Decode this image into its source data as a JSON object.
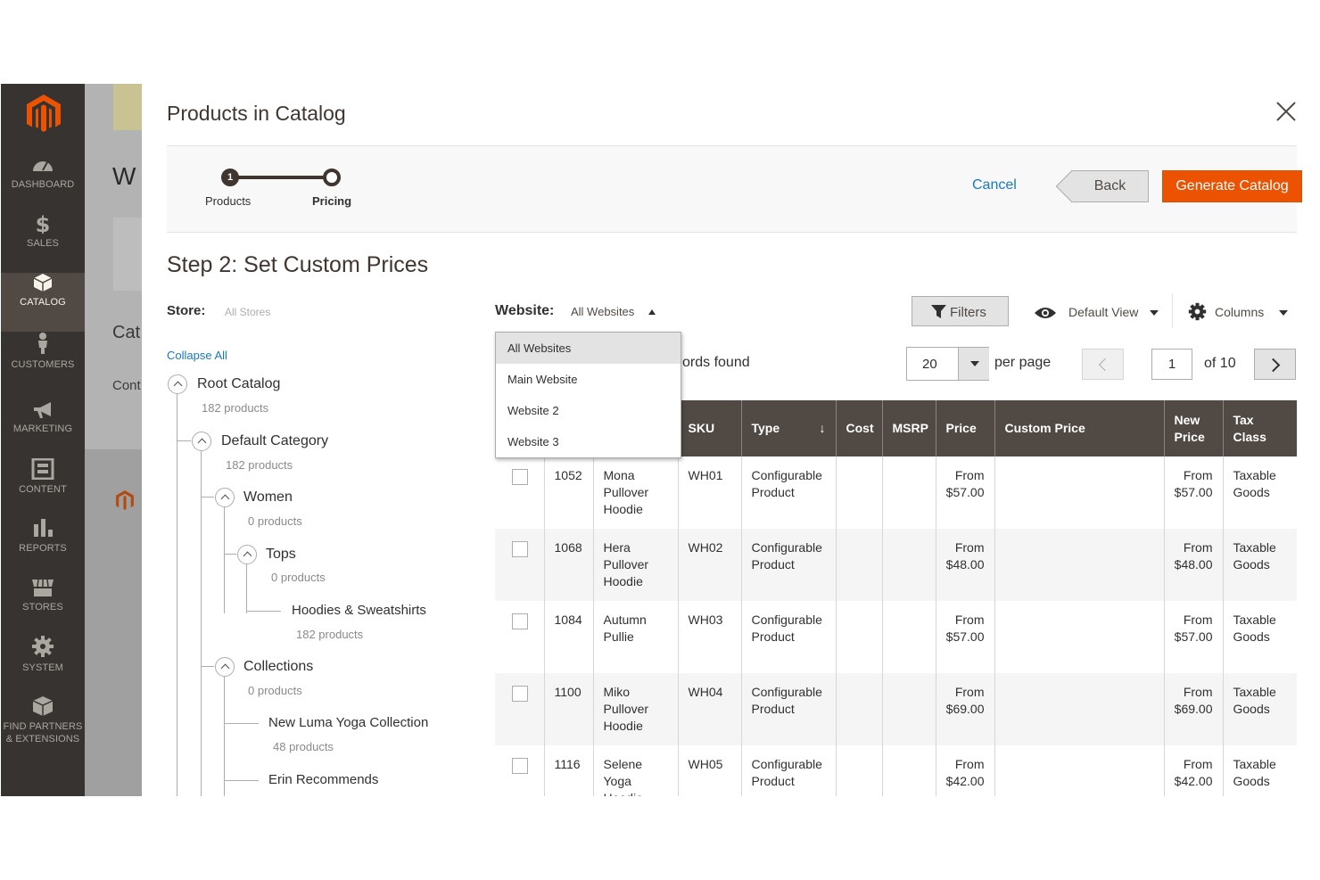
{
  "admin_nav": {
    "items": [
      {
        "label": "DASHBOARD",
        "icon": "dashboard-icon"
      },
      {
        "label": "SALES",
        "icon": "dollar-icon"
      },
      {
        "label": "CATALOG",
        "icon": "cube-icon"
      },
      {
        "label": "CUSTOMERS",
        "icon": "person-icon"
      },
      {
        "label": "MARKETING",
        "icon": "megaphone-icon"
      },
      {
        "label": "CONTENT",
        "icon": "content-icon"
      },
      {
        "label": "REPORTS",
        "icon": "bar-chart-icon"
      },
      {
        "label": "STORES",
        "icon": "store-icon"
      },
      {
        "label": "SYSTEM",
        "icon": "gear-icon"
      },
      {
        "label_1": "FIND PARTNERS",
        "label_2": "& EXTENSIONS",
        "icon": "box-icon"
      }
    ],
    "active": "CATALOG"
  },
  "background_page": {
    "title_fragment": "W",
    "label_fragment_1": "Cat",
    "label_fragment_2": "Cont"
  },
  "modal": {
    "title": "Products in Catalog",
    "steps": [
      {
        "number": "1",
        "label": "Products"
      },
      {
        "label": "Pricing"
      }
    ],
    "cancel_label": "Cancel",
    "back_label": "Back",
    "generate_label": "Generate Catalog",
    "step_title": "Step 2: Set Custom Prices"
  },
  "tree": {
    "store_label": "Store:",
    "store_value": "All Stores",
    "collapse_label": "Collapse All",
    "nodes": [
      {
        "name": "Root Catalog",
        "count": "182 products"
      },
      {
        "name": "Default Category",
        "count": "182 products"
      },
      {
        "name": "Women",
        "count": "0 products"
      },
      {
        "name": "Tops",
        "count": "0 products"
      },
      {
        "name": "Hoodies & Sweatshirts",
        "count": "182 products"
      },
      {
        "name": "Collections",
        "count": "0 products"
      },
      {
        "name": "New Luma Yoga Collection",
        "count": "48 products"
      },
      {
        "name": "Erin Recommends"
      }
    ]
  },
  "toolbar": {
    "website_label": "Website:",
    "website_value": "All Websites",
    "website_options": [
      "All Websites",
      "Main Website",
      "Website 2",
      "Website 3"
    ],
    "records_found": "ords found",
    "filters_label": "Filters",
    "view_label": "Default View",
    "columns_label": "Columns",
    "per_page_value": "20",
    "per_page_label": "per page",
    "page_value": "1",
    "page_of": "of 10"
  },
  "grid": {
    "headers": [
      "SKU",
      "Type",
      "Cost",
      "MSRP",
      "Price",
      "Custom Price",
      "New Price",
      "Tax Class"
    ],
    "sort_indicator": "↓",
    "rows": [
      {
        "id": "1052",
        "name": "Mona Pullover Hoodie",
        "sku": "WH01",
        "type": "Configurable Product",
        "price": "From $57.00",
        "new_price": "From $57.00",
        "tax": "Taxable Goods"
      },
      {
        "id": "1068",
        "name": "Hera Pullover Hoodie",
        "sku": "WH02",
        "type": "Configurable Product",
        "price": "From $48.00",
        "new_price": "From $48.00",
        "tax": "Taxable Goods"
      },
      {
        "id": "1084",
        "name": "Autumn Pullie",
        "sku": "WH03",
        "type": "Configurable Product",
        "price": "From $57.00",
        "new_price": "From $57.00",
        "tax": "Taxable Goods"
      },
      {
        "id": "1100",
        "name": "Miko Pullover Hoodie",
        "sku": "WH04",
        "type": "Configurable Product",
        "price": "From $69.00",
        "new_price": "From $69.00",
        "tax": "Taxable Goods"
      },
      {
        "id": "1116",
        "name": "Selene Yoga Hoodie",
        "sku": "WH05",
        "type": "Configurable Product",
        "price": "From $42.00",
        "new_price": "From $42.00",
        "tax": "Taxable Goods"
      }
    ]
  },
  "colors": {
    "accent": "#eb5202",
    "nav_bg": "#373330",
    "header_bg": "#514943",
    "link": "#1979c3"
  }
}
